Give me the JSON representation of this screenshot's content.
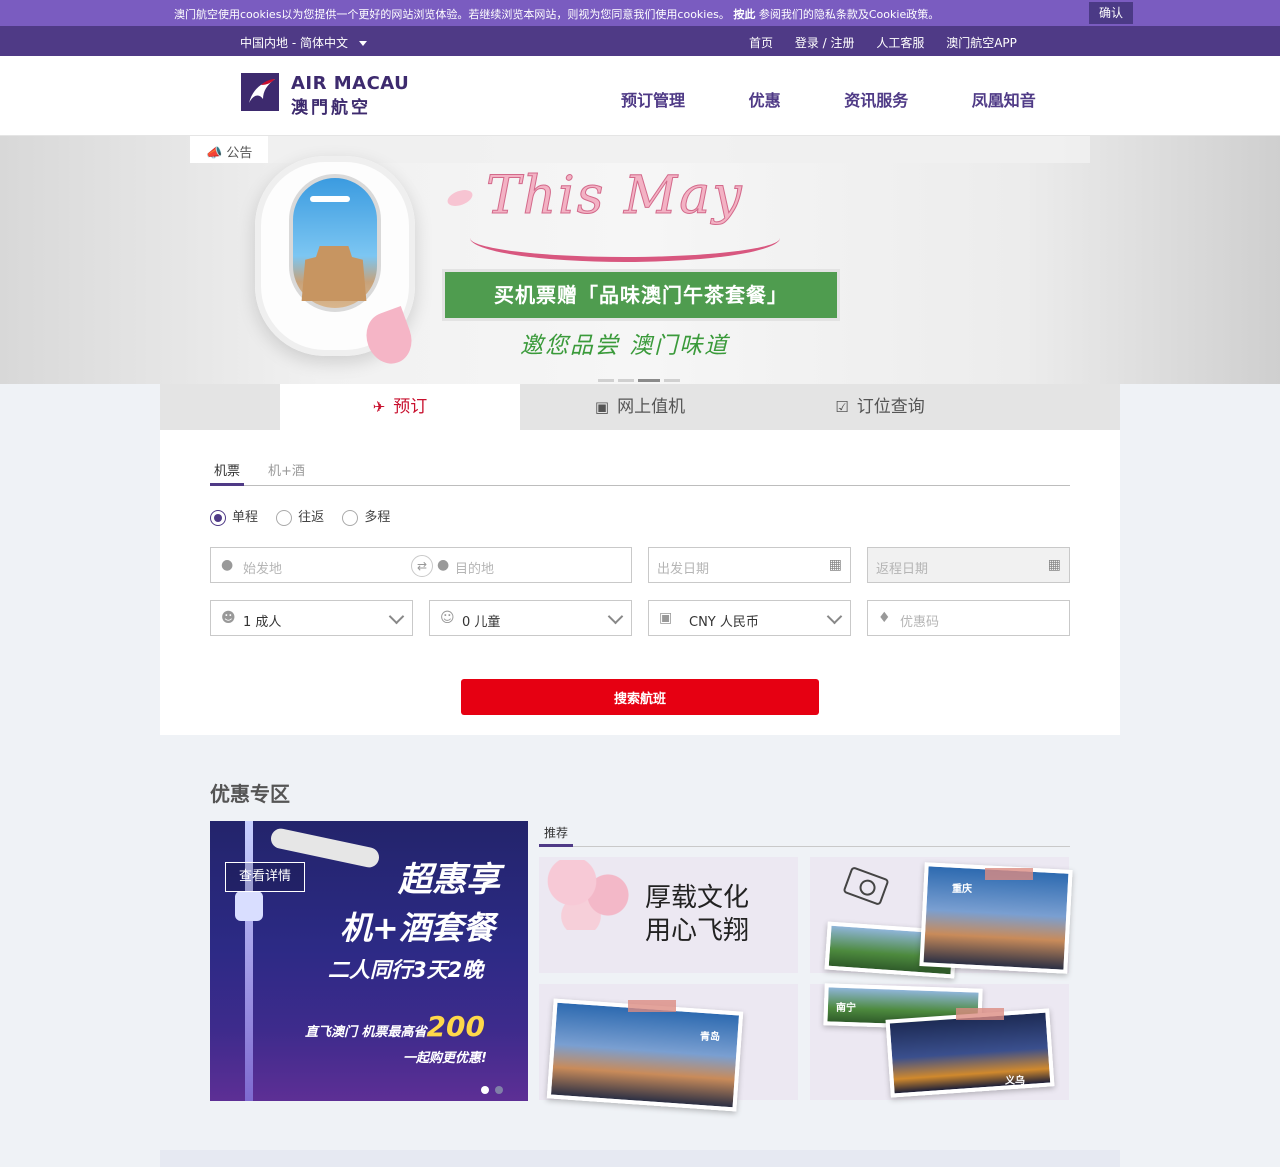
{
  "cookie": {
    "text_prefix": "澳门航空使用cookies以为您提供一个更好的网站浏览体验。若继续浏览本网站，则视为您同意我们使用cookies。",
    "bold_link": "按此",
    "text_suffix": " 参阅我们的隐私条款及Cookie政策。",
    "confirm_label": "确认"
  },
  "topnav": {
    "locale": "中国内地 - 简体中文",
    "links": [
      "首页",
      "登录 / 注册",
      "人工客服",
      "澳门航空APP"
    ]
  },
  "header": {
    "logo_en": "AIR MACAU",
    "logo_cn": "澳門航空",
    "nav": [
      "预订管理",
      "优惠",
      "资讯服务",
      "凤凰知音"
    ]
  },
  "banner": {
    "notice_label": "公告",
    "script_title": "This May",
    "promo_text": "买机票赠「品味澳门午茶套餐」",
    "promo_sub": "邀您品尝  澳门味道"
  },
  "booking": {
    "tabs": [
      "预订",
      "网上值机",
      "订位查询"
    ],
    "subtabs": [
      "机票",
      "机+酒"
    ],
    "trip_types": [
      "单程",
      "往返",
      "多程"
    ],
    "origin_placeholder": "始发地",
    "destination_placeholder": "目的地",
    "depart_placeholder": "出发日期",
    "return_placeholder": "返程日期",
    "adults": "1 成人",
    "children": "0 儿童",
    "currency": "CNY 人民币",
    "promo_placeholder": "优惠码",
    "search_label": "搜索航班"
  },
  "deals": {
    "title": "优惠专区",
    "detail_button": "查看详情",
    "main_line1": "超惠享",
    "main_line2": "机+酒套餐",
    "main_line3": "二人同行3天2晚",
    "main_line4_prefix": "直飞澳门  机票最高省",
    "main_line4_num": "200",
    "main_line5": "一起购更优惠!",
    "rec_tab": "推荐",
    "culture_title": "厚载文化\n用心飞翔",
    "labels": {
      "chongqing": "重庆",
      "nanning": "南宁",
      "qingdao": "青岛",
      "yiwu": "义乌"
    }
  },
  "colors": {
    "brand_purple": "#4f3a86",
    "cookie_purple": "#7a5cc0",
    "accent_red": "#e60012",
    "promo_green": "#4f9c4f"
  }
}
